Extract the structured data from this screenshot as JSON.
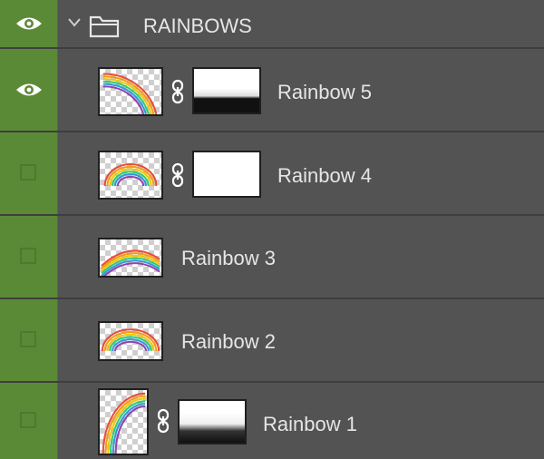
{
  "panel": "Layers",
  "group": {
    "name": "RAINBOWS",
    "visible": true,
    "expanded": true,
    "icon": "folder-icon"
  },
  "layers": [
    {
      "name": "Rainbow 5",
      "visible": true,
      "has_mask": true,
      "linked": true,
      "mask": "black-bottom"
    },
    {
      "name": "Rainbow 4",
      "visible": false,
      "has_mask": true,
      "linked": true,
      "mask": "white"
    },
    {
      "name": "Rainbow 3",
      "visible": false,
      "has_mask": false,
      "linked": false
    },
    {
      "name": "Rainbow 2",
      "visible": false,
      "has_mask": false,
      "linked": false
    },
    {
      "name": "Rainbow 1",
      "visible": false,
      "has_mask": true,
      "linked": true,
      "mask": "gradient"
    }
  ],
  "colors": {
    "panel_bg": "#535353",
    "visibility_column": "#5b8a37",
    "text": "#e6e6e6",
    "row_divider": "#3e3e3e"
  }
}
